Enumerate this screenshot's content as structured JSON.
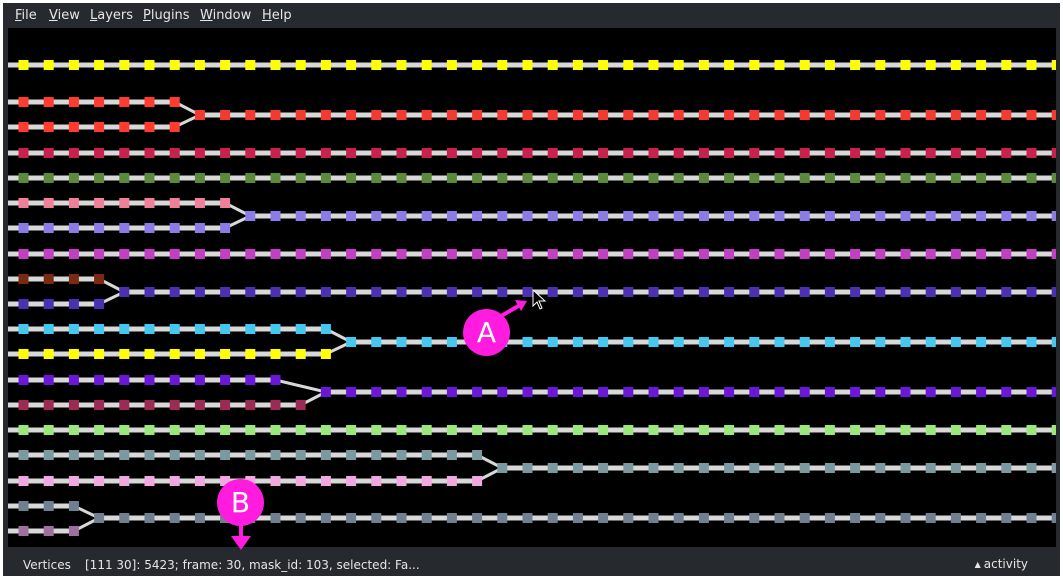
{
  "menu": {
    "file": {
      "u": "F",
      "rest": "ile"
    },
    "view": {
      "u": "V",
      "rest": "iew"
    },
    "layers": {
      "u": "L",
      "rest": "ayers"
    },
    "plugins": {
      "u": "P",
      "rest": "lugins"
    },
    "window": {
      "u": "W",
      "rest": "indow"
    },
    "help": {
      "u": "H",
      "rest": "elp"
    }
  },
  "status": {
    "layer": "Vertices",
    "coords": "[111 30]: 5423; frame: 30, mask_id: 103, selected: Fa...",
    "activity": "activity"
  },
  "annotations": {
    "a": "A",
    "b": "B",
    "color": "#ff1cde"
  },
  "icons": {
    "activity_caret": "▲",
    "cursor": "mouse-pointer-icon"
  },
  "colors": {
    "background": "#26292e",
    "canvas": "#000000",
    "track_line": "#d8d8d8",
    "annotation": "#ff1cde"
  },
  "tracks": [
    {
      "id": "yellow",
      "color": "#ffff00"
    },
    {
      "id": "red-branch-a",
      "color": "#ff3b2f"
    },
    {
      "id": "red-branch-b",
      "color": "#ff3b2f"
    },
    {
      "id": "red-merged",
      "color": "#f23a2e"
    },
    {
      "id": "crimson",
      "color": "#c8204f"
    },
    {
      "id": "olive-green",
      "color": "#5a8a3a"
    },
    {
      "id": "pink",
      "color": "#f07f9a"
    },
    {
      "id": "lavender-branch",
      "color": "#8a7be6"
    },
    {
      "id": "lavender-merged",
      "color": "#8a7be6"
    },
    {
      "id": "magenta",
      "color": "#c23ec2"
    },
    {
      "id": "brown",
      "color": "#7a2a12"
    },
    {
      "id": "indigo-branch",
      "color": "#4b30b0"
    },
    {
      "id": "indigo-merged",
      "color": "#4b30b0"
    },
    {
      "id": "cyan",
      "color": "#45c8f0"
    },
    {
      "id": "yellow-2",
      "color": "#ffff00"
    },
    {
      "id": "cyan-merged",
      "color": "#45c8f0"
    },
    {
      "id": "violet",
      "color": "#6a17d8"
    },
    {
      "id": "maroon",
      "color": "#9b2a55"
    },
    {
      "id": "violet-merged",
      "color": "#6a17d8"
    },
    {
      "id": "light-green",
      "color": "#9ae87a"
    },
    {
      "id": "slate-teal",
      "color": "#7a9aa0"
    },
    {
      "id": "light-pink",
      "color": "#f0a8e0"
    },
    {
      "id": "slate-merged",
      "color": "#7a9aa0"
    },
    {
      "id": "gray-blue",
      "color": "#708090"
    },
    {
      "id": "mauve",
      "color": "#a070a0"
    },
    {
      "id": "gray-merged",
      "color": "#708090"
    }
  ]
}
